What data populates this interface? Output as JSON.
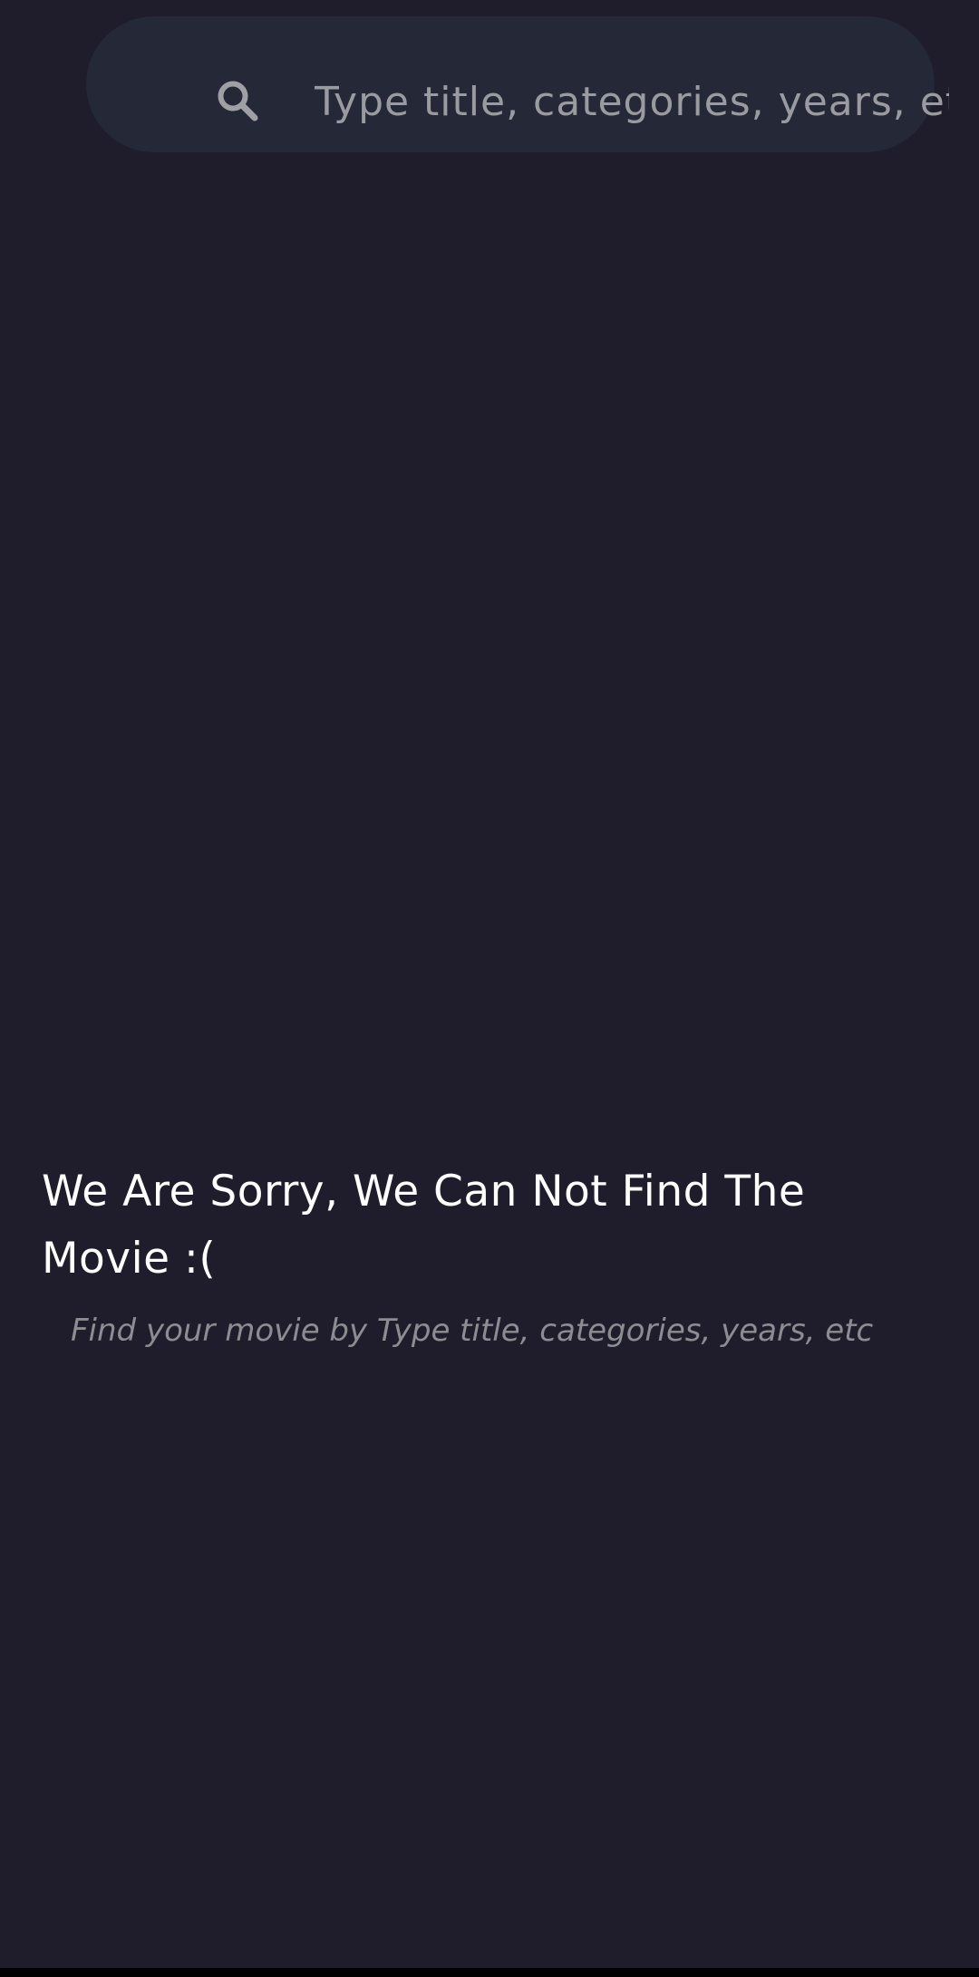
{
  "search": {
    "placeholder": "Type title, categories, years, etc",
    "icon": "search-icon"
  },
  "empty_state": {
    "title": "We Are Sorry, We Can Not Find The Movie :(",
    "subtitle": "Find your movie by Type title, categories, years, etc"
  },
  "colors": {
    "background": "#1f1d2b",
    "search_background": "#252836",
    "title": "#ffffff",
    "muted_text": "#8c8d93"
  }
}
